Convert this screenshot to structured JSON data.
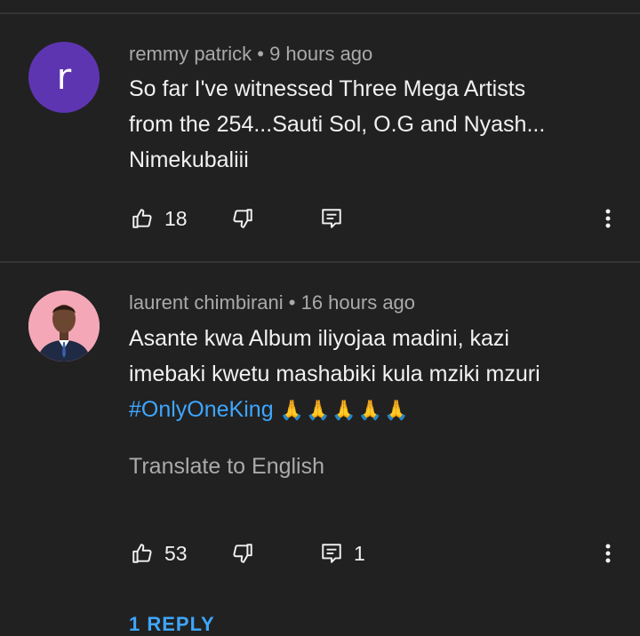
{
  "comments": [
    {
      "author": "remmy patrick",
      "separator": "•",
      "time": "9 hours ago",
      "avatar_letter": "r",
      "text_lines": [
        "So far I've witnessed Three Mega Artists",
        "from the 254...Sauti Sol, O.G and Nyash...",
        "Nimekubaliii"
      ],
      "likes": "18",
      "replies": ""
    },
    {
      "author": "laurent chimbirani",
      "separator": "•",
      "time": "16 hours ago",
      "text_lines": [
        "Asante kwa Album iliyojaa madini, kazi",
        "imebaki kwetu mashabiki kula mziki mzuri"
      ],
      "hashtag": "#OnlyOneKing",
      "emojis": "🙏🙏🙏🙏🙏",
      "translate_label": "Translate to English",
      "likes": "53",
      "replies": "1"
    }
  ],
  "reply_link_partial": "1 REPLY",
  "colors": {
    "background": "#212121",
    "accent_link": "#3ea6ff",
    "avatar_purple": "#5e35b1"
  }
}
